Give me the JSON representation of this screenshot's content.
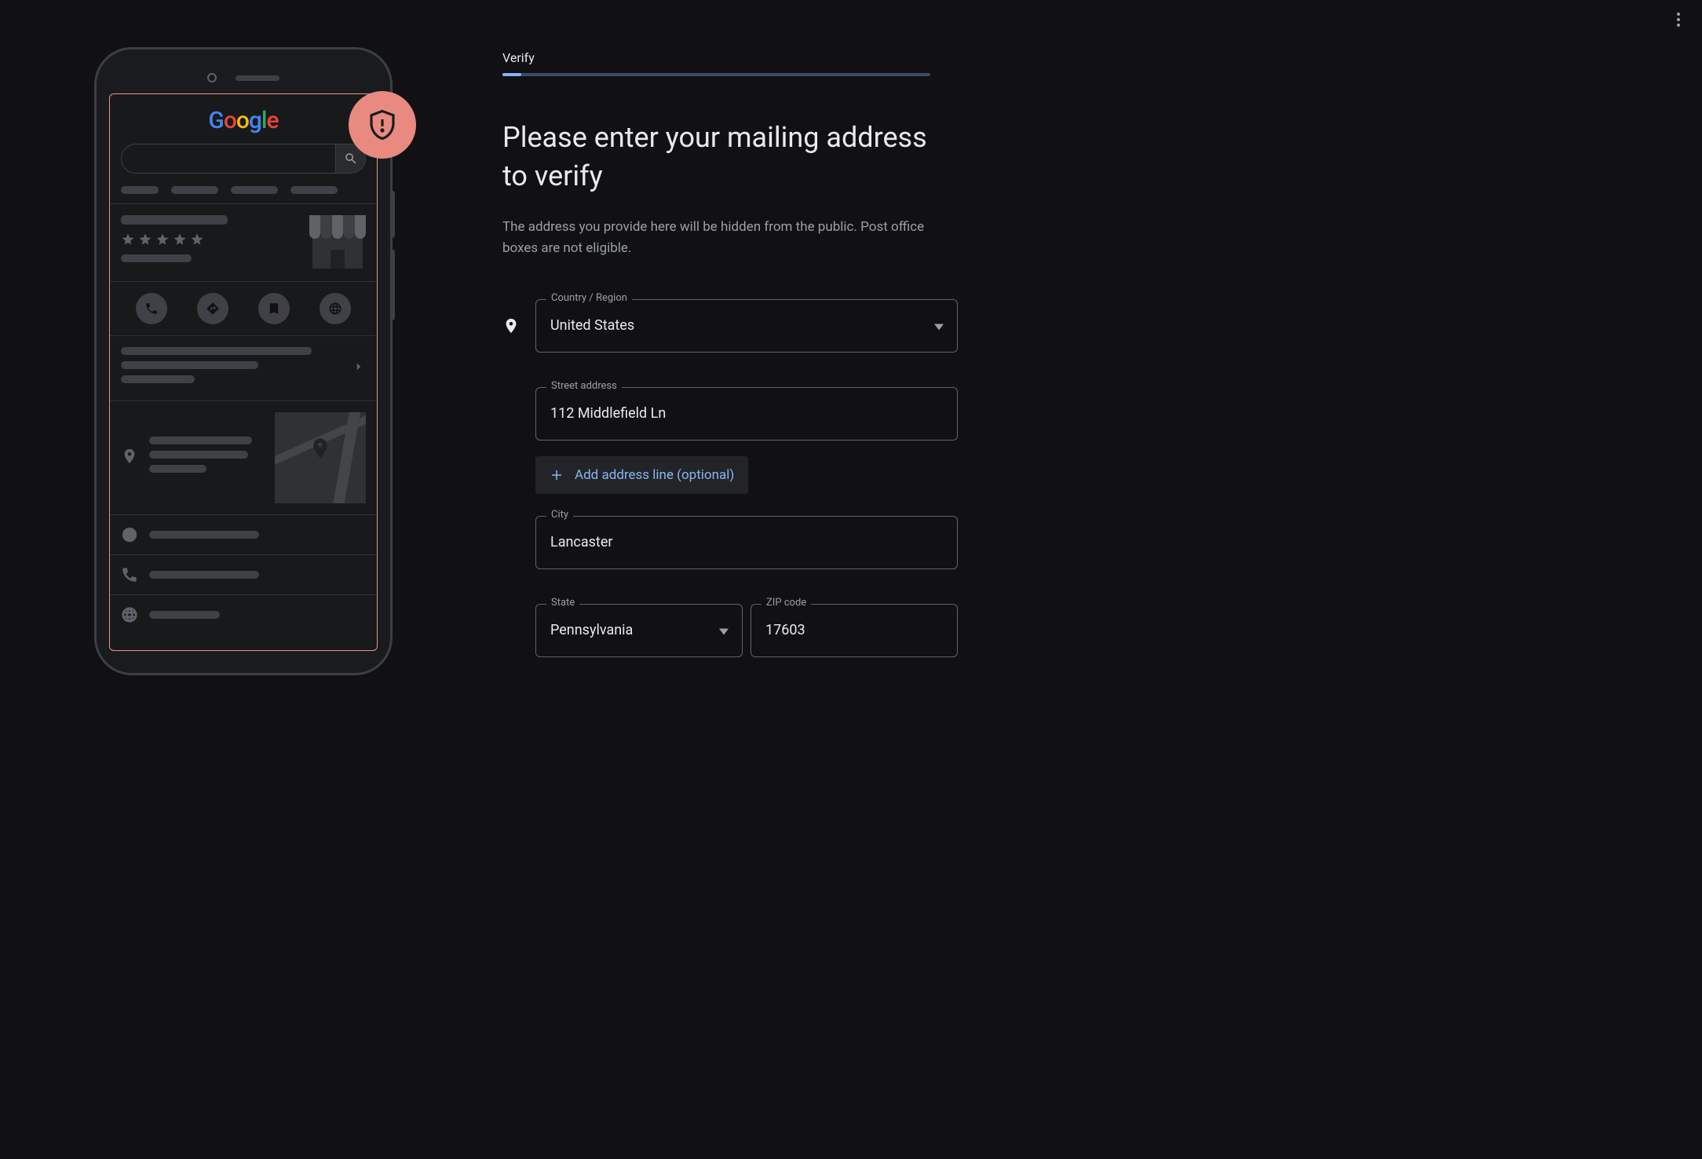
{
  "topRight": {
    "moreMenu": "more-options"
  },
  "phone": {
    "logoLetters": [
      "G",
      "o",
      "o",
      "g",
      "l",
      "e"
    ],
    "shieldBadge": "shield-alert"
  },
  "step": {
    "label": "Verify",
    "progressPercent": 4
  },
  "heading": "Please enter your mailing address to verify",
  "subheading": "The address you provide here will be hidden from the public. Post office boxes are not eligible.",
  "fields": {
    "countryLabel": "Country / Region",
    "countryValue": "United States",
    "streetLabel": "Street address",
    "streetValue": "112 Middlefield Ln",
    "addLineLabel": "Add address line (optional)",
    "cityLabel": "City",
    "cityValue": "Lancaster",
    "stateLabel": "State",
    "stateValue": "Pennsylvania",
    "zipLabel": "ZIP code",
    "zipValue": "17603"
  }
}
